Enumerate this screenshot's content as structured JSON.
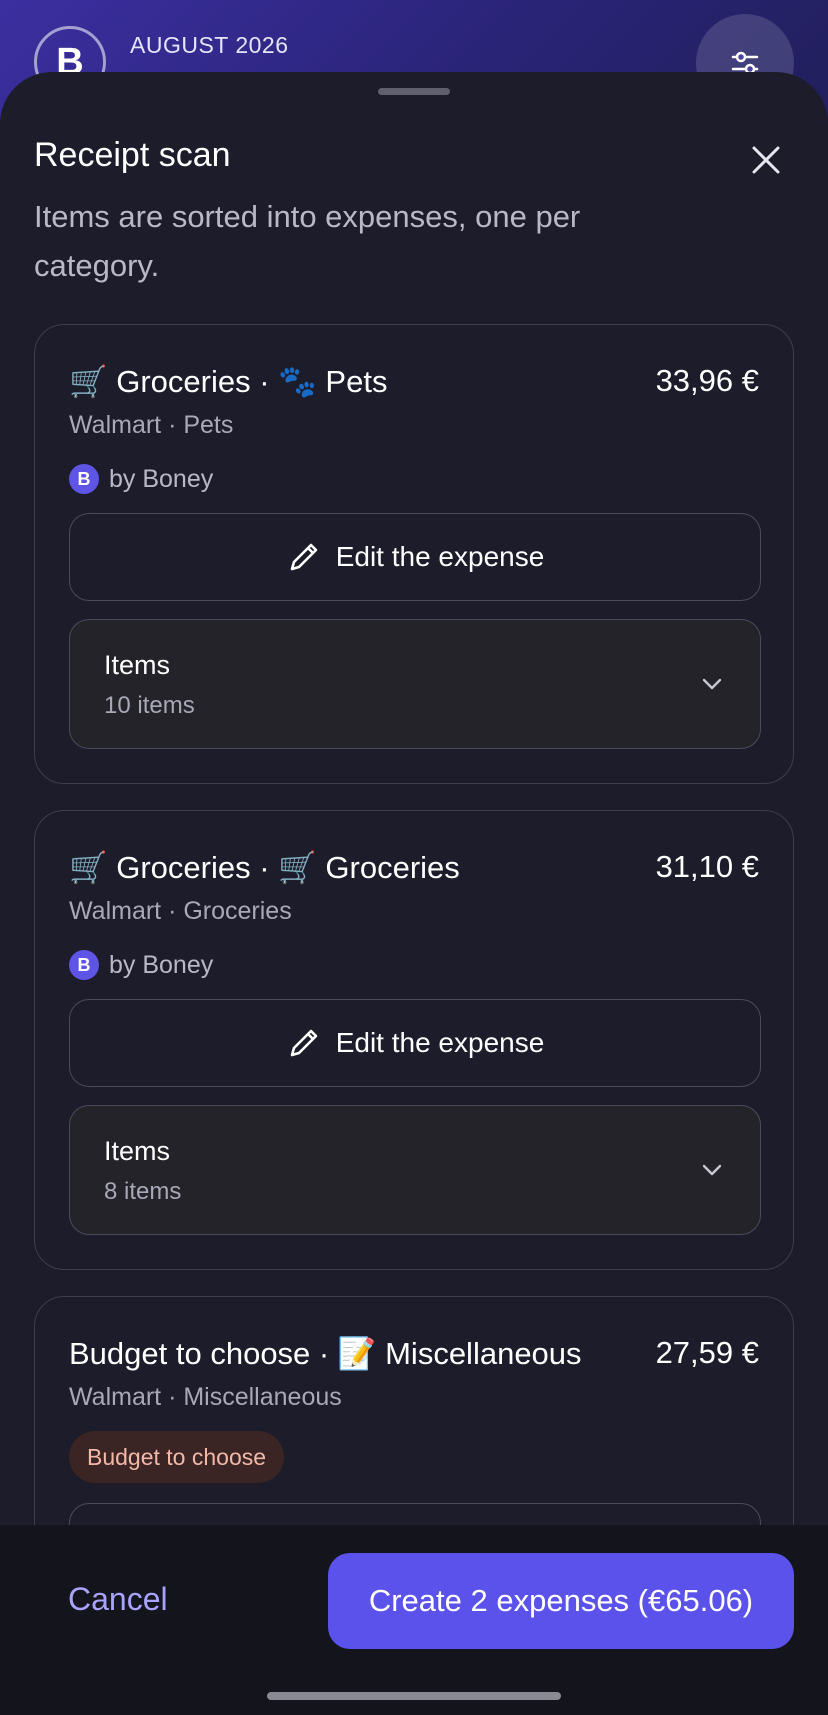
{
  "background": {
    "logo_letter": "B",
    "month": "AUGUST 2026"
  },
  "sheet": {
    "title": "Receipt scan",
    "subtitle": "Items are sorted into expenses, one per category."
  },
  "cards": [
    {
      "title_part1": "Groceries",
      "separator": "·",
      "title_part2": "Pets",
      "amount": "33,96 €",
      "subtitle": "Walmart · Pets",
      "by_badge": "B",
      "by_text": "by Boney",
      "edit_label": "Edit the expense",
      "items_title": "Items",
      "items_count": "10 items"
    },
    {
      "title_part1": "Groceries",
      "separator": "·",
      "title_part2": "Groceries",
      "amount": "31,10 €",
      "subtitle": "Walmart · Groceries",
      "by_badge": "B",
      "by_text": "by Boney",
      "edit_label": "Edit the expense",
      "items_title": "Items",
      "items_count": "8 items"
    },
    {
      "title_part1": "Budget to choose",
      "separator": "·",
      "title_part2": "Miscellaneous",
      "amount": "27,59 €",
      "subtitle": "Walmart · Miscellaneous",
      "badge": "Budget to choose"
    }
  ],
  "footer": {
    "cancel_label": "Cancel",
    "create_label": "Create 2 expenses (€65.06)"
  },
  "colors": {
    "accent": "#5b52ec",
    "sheet_bg": "#1c1c2b",
    "badge_text": "#f2b8a8"
  }
}
